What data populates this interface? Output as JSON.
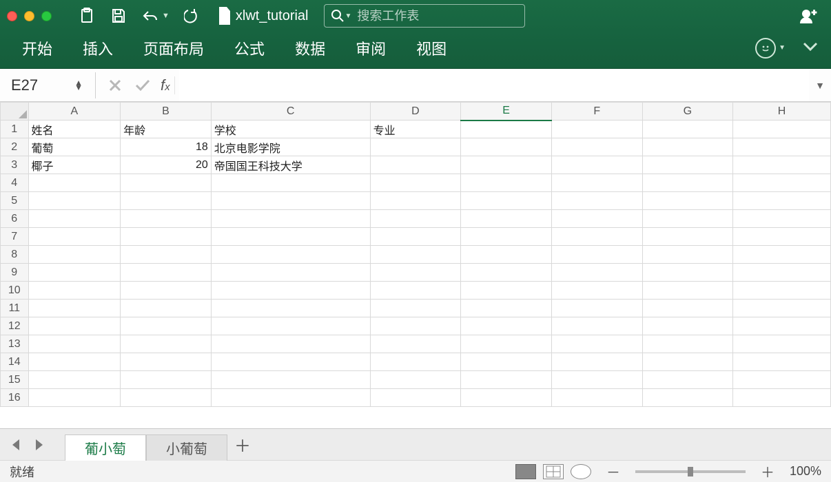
{
  "title": "xlwt_tutorial",
  "search_placeholder": "搜索工作表",
  "ribbon_tabs": [
    "开始",
    "插入",
    "页面布局",
    "公式",
    "数据",
    "审阅",
    "视图"
  ],
  "name_box": "E27",
  "formula_value": "",
  "columns": [
    "A",
    "B",
    "C",
    "D",
    "E",
    "F",
    "G",
    "H"
  ],
  "active_column": "E",
  "visible_row_count": 16,
  "cells": {
    "A1": "姓名",
    "B1": "年龄",
    "C1": "学校",
    "D1": "专业",
    "A2": "葡萄",
    "B2": "18",
    "C2": "北京电影学院",
    "A3": "椰子",
    "B3": "20",
    "C3": "帝国国王科技大学"
  },
  "numeric_cells": [
    "B2",
    "B3"
  ],
  "sheet_tabs": [
    {
      "name": "葡小萄",
      "active": true
    },
    {
      "name": "小葡萄",
      "active": false
    }
  ],
  "status_text": "就绪",
  "zoom_label": "100%",
  "zoom_value": 100
}
